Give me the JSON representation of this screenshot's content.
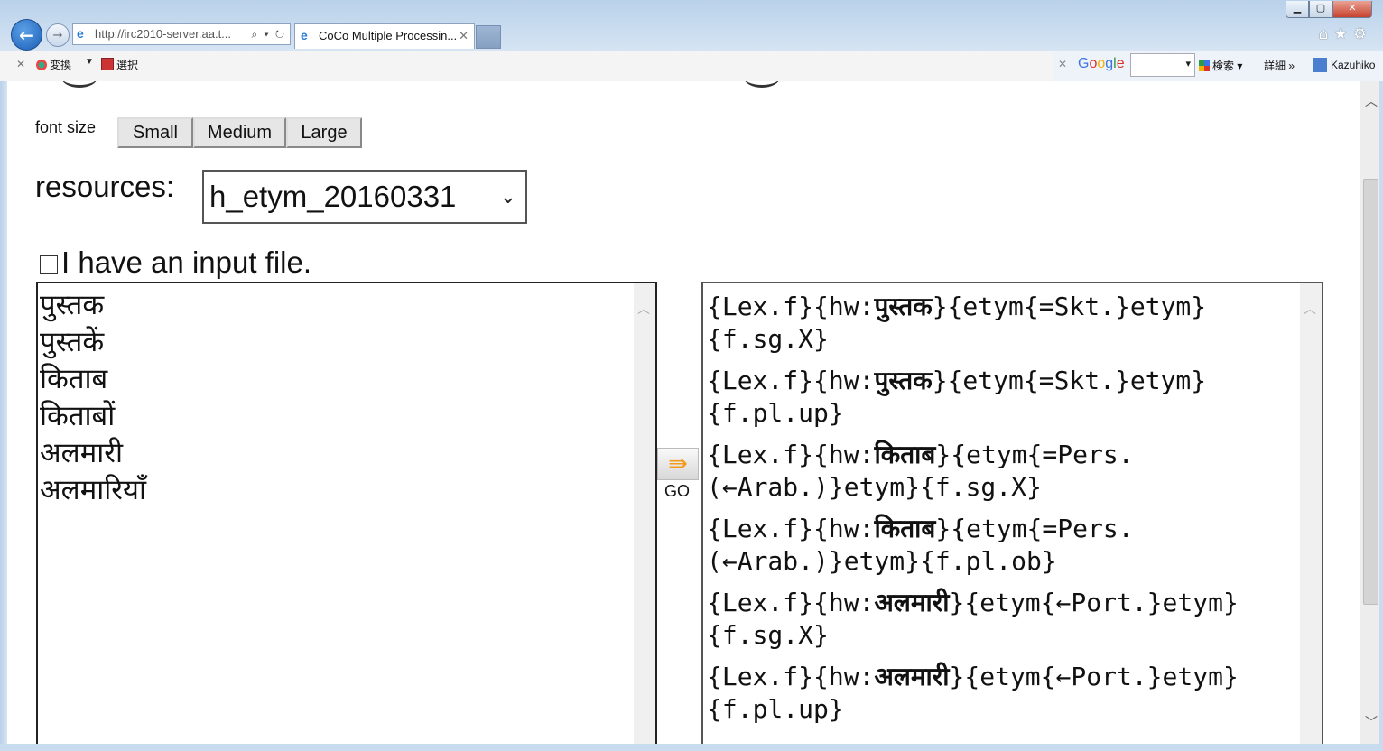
{
  "browser": {
    "window_controls": {
      "minimize": "▁",
      "maximize": "▢",
      "close": "✕"
    },
    "back_icon": "←",
    "forward_icon": "→",
    "address_url": "http://irc2010-server.aa.t...",
    "address_icons": "⌕ ▾ ↻",
    "active_tab_title": "CoCo Multiple Processin...",
    "tab_close": "✕",
    "right_icons": "⌂★⚙"
  },
  "toolbar": {
    "close": "✕",
    "convert_label": "変換",
    "dropdown_arrow": "▼",
    "select_label": "選択",
    "google_close": "✕",
    "search_label": "検索 ▾",
    "detail_label": "詳細 »",
    "user_label": "Kazuhiko"
  },
  "page": {
    "font_size_label": "font size",
    "font_buttons": {
      "small": "Small",
      "medium": "Medium",
      "large": "Large"
    },
    "resources_label": "resources:",
    "resources_selected": "h_etym_20160331",
    "resources_chevron": "⌄",
    "input_file_label": "I have an input file.",
    "input_lines": [
      "पुस्तक",
      "पुस्तकें",
      "किताब",
      "किताबों",
      "अलमारी",
      "अलमारियाँ"
    ],
    "go_label": "GO",
    "go_icon": "⇛",
    "output": [
      {
        "pre": " {Lex.f}{hw:",
        "hw": "पुस्तक",
        "post": "}{etym{=Skt.}etym}{f.sg.X}"
      },
      {
        "pre": " {Lex.f}{hw:",
        "hw": "पुस्तक",
        "post": "}{etym{=Skt.}etym}{f.pl.up}"
      },
      {
        "pre": " {Lex.f}{hw:",
        "hw": "किताब",
        "post": "}{etym{=Pers.(←Arab.)}etym}{f.sg.X}"
      },
      {
        "pre": " {Lex.f}{hw:",
        "hw": "किताब",
        "post": "}{etym{=Pers.(←Arab.)}etym}{f.pl.ob}"
      },
      {
        "pre": " {Lex.f}{hw:",
        "hw": "अलमारी",
        "post": "}{etym{←Port.}etym}{f.sg.X}"
      },
      {
        "pre": " {Lex.f}{hw:",
        "hw": "अलमारी",
        "post": "}{etym{←Port.}etym}{f.pl.up}"
      }
    ]
  },
  "scroll_icons": {
    "up": "︿",
    "down": "﹀"
  }
}
